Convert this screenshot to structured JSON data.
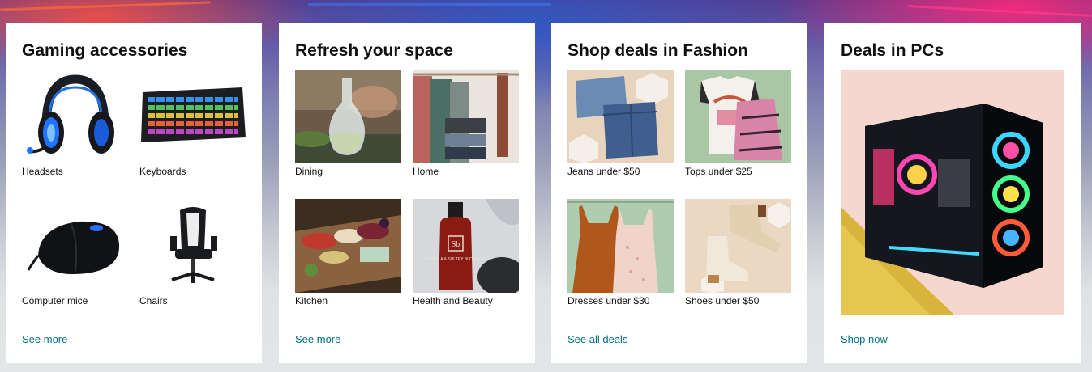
{
  "cards": [
    {
      "title": "Gaming accessories",
      "items": [
        {
          "label": "Headsets",
          "icon": "headset-icon"
        },
        {
          "label": "Keyboards",
          "icon": "keyboard-icon"
        },
        {
          "label": "Computer mice",
          "icon": "mouse-icon"
        },
        {
          "label": "Chairs",
          "icon": "chair-icon"
        }
      ],
      "link": "See more"
    },
    {
      "title": "Refresh your space",
      "items": [
        {
          "label": "Dining",
          "icon": "carafe-icon"
        },
        {
          "label": "Home",
          "icon": "towels-icon"
        },
        {
          "label": "Kitchen",
          "icon": "charcuterie-board-icon"
        },
        {
          "label": "Health and Beauty",
          "icon": "soap-bottle-icon"
        }
      ],
      "link": "See more"
    },
    {
      "title": "Shop deals in Fashion",
      "items": [
        {
          "label": "Jeans under $50",
          "icon": "jeans-icon"
        },
        {
          "label": "Tops under $25",
          "icon": "tops-icon"
        },
        {
          "label": "Dresses under $30",
          "icon": "dresses-icon"
        },
        {
          "label": "Shoes under $50",
          "icon": "boots-icon"
        }
      ],
      "link": "See all deals"
    },
    {
      "title": "Deals in PCs",
      "image": {
        "icon": "gaming-pc-icon"
      },
      "link": "Shop now"
    }
  ],
  "product_texts": {
    "soap_brand": "Sb",
    "soap_name": "VANILLA & SULTRY BLOSSOM"
  },
  "colors": {
    "link": "#007185",
    "title": "#0f1111",
    "card_bg": "#ffffff",
    "page_bg": "#e3e6e6"
  }
}
